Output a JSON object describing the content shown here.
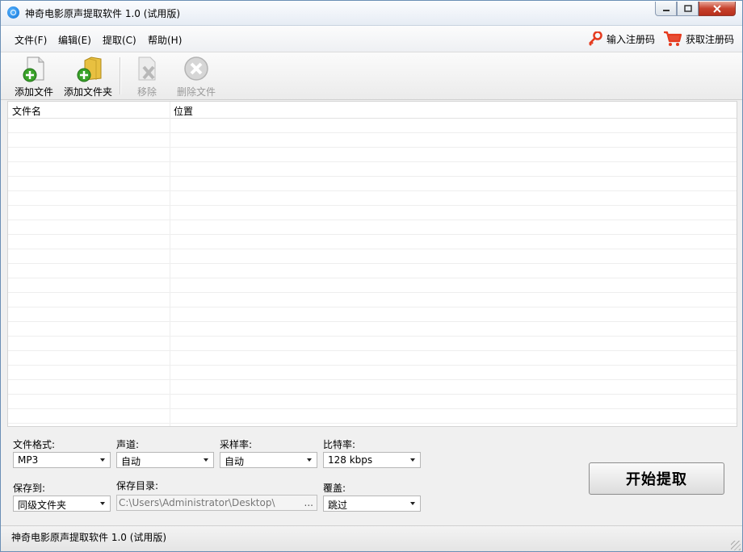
{
  "window": {
    "title": "神奇电影原声提取软件 1.0 (试用版)"
  },
  "menu": {
    "items": [
      "文件(F)",
      "编辑(E)",
      "提取(C)",
      "帮助(H)"
    ],
    "enter_code": "输入注册码",
    "get_code": "获取注册码"
  },
  "toolbar": {
    "add_file": "添加文件",
    "add_folder": "添加文件夹",
    "remove": "移除",
    "delete_file": "删除文件"
  },
  "file_list": {
    "columns": [
      "文件名",
      "位置"
    ],
    "rows": []
  },
  "settings": {
    "format_label": "文件格式:",
    "format_value": "MP3",
    "channel_label": "声道:",
    "channel_value": "自动",
    "samplerate_label": "采样率:",
    "samplerate_value": "自动",
    "bitrate_label": "比特率:",
    "bitrate_value": "128 kbps",
    "save_to_label": "保存到:",
    "save_to_value": "同级文件夹",
    "save_dir_label": "保存目录:",
    "save_dir_value": "C:\\Users\\Administrator\\Desktop\\",
    "browse": "...",
    "overwrite_label": "覆盖:",
    "overwrite_value": "跳过",
    "start_button": "开始提取"
  },
  "status": {
    "text": "神奇电影原声提取软件 1.0 (试用版)"
  },
  "colors": {
    "accent_red": "#e53b1f",
    "title_gradient_top": "#fbfcfe",
    "window_bg": "#f0f0f0"
  }
}
